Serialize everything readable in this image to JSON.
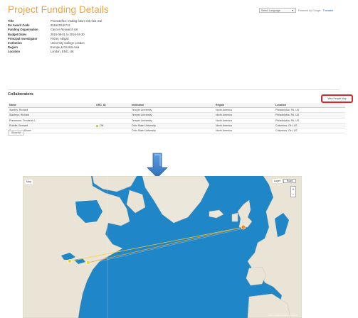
{
  "page": {
    "title": "Project Funding Details"
  },
  "translate": {
    "select_label": "Select Language",
    "powered_by": "Powered by Google",
    "translate_label": "Translate"
  },
  "details": [
    {
      "label": "Title",
      "value": "Prometeflex: making future risk fast real"
    },
    {
      "label": "RA Award Code",
      "value": "2016CRUK712"
    },
    {
      "label": "Funding Organisation",
      "value": "Cancer Research UK"
    },
    {
      "label": "Budget Dates",
      "value": "2015-09-01 to 2016-04-30"
    },
    {
      "label": "Principal Investigator",
      "value": "Fisher, Abigail"
    },
    {
      "label": "Institution",
      "value": "University College London"
    },
    {
      "label": "Region",
      "value": "Europe & Central Asia"
    },
    {
      "label": "Location",
      "value": "London, ENG, UK"
    }
  ],
  "collaborators": {
    "heading": "Collaborators",
    "people_map_button": "View People Map",
    "columns": [
      "Name",
      "ORC_ID",
      "Institution",
      "Region",
      "Location"
    ],
    "rows": [
      {
        "name": "Stanley, Richard",
        "orcid": "",
        "institution": "Temple University",
        "region": "North America",
        "location": "Philadelphia, PA, US"
      },
      {
        "name": "Stanleys, Richard",
        "orcid": "",
        "institution": "Temple University",
        "region": "North America",
        "location": "Philadelphia, PA, US"
      },
      {
        "name": "Primezone, Frederick L.",
        "orcid": "",
        "institution": "Temple University",
        "region": "North America",
        "location": "Philadelphia, PA, US"
      },
      {
        "name": "Ruddle, Bernard",
        "orcid": "ON",
        "institution": "Ohio State University",
        "region": "North America",
        "location": "Columbus, OH, US"
      },
      {
        "name": "Springsteen, Bruce",
        "orcid": "",
        "institution": "Ohio State University",
        "region": "North America",
        "location": "Columbus, OH, US"
      }
    ],
    "show_all": "Show All"
  },
  "map": {
    "view_label": "Map",
    "layer_label": "Layer",
    "layer_select": "Road",
    "zoom_in": "+",
    "zoom_out": "−",
    "attribution": "Leaflet | © OpenStreetMap contributors"
  },
  "colors": {
    "title": "#f0a23b",
    "ocean": "#1f86c8",
    "land": "#e9e4d6",
    "highlight": "#d9262c",
    "marker_orange": "#f08a24",
    "marker_yellow": "#f5d22a",
    "arrow": "#4a8fd6"
  }
}
